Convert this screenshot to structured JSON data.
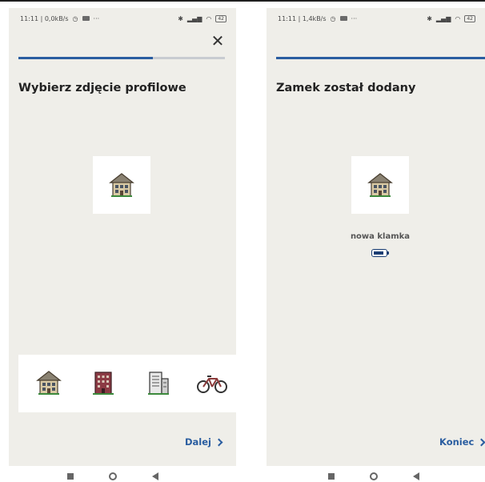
{
  "screens": [
    {
      "status": {
        "left": "11:11 | 0,0kB/s",
        "right": "42"
      },
      "close_label": "✕",
      "progress": 0.65,
      "title": "Wybierz zdjęcie profilowe",
      "avatar_icon": "house-icon",
      "picker_options": [
        "house-icon",
        "red-apartment-icon",
        "office-building-icon",
        "bicycle-icon"
      ],
      "next_label": "Dalej"
    },
    {
      "status": {
        "left": "11:11 | 1,4kB/s",
        "right": "42"
      },
      "progress": 1.0,
      "title": "Zamek został dodany",
      "avatar_icon": "house-icon",
      "device_name": "nowa klamka",
      "battery_level": 0.8,
      "next_label": "Koniec"
    }
  ],
  "colors": {
    "accent": "#2a5da0",
    "background": "#efeee9",
    "card": "#ffffff",
    "track": "#c8cbd1"
  }
}
